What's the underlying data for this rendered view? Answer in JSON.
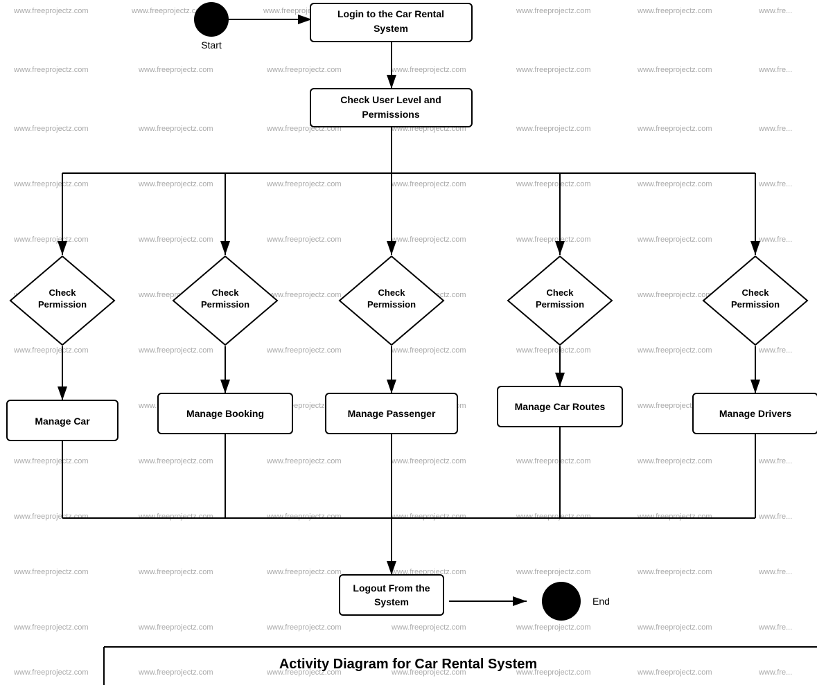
{
  "title": "Activity Diagram for Car Rental System",
  "watermark_text": "www.freeprojectz.com",
  "nodes": {
    "start": {
      "label": "Start"
    },
    "login": {
      "label": "Login to the Car Rental System"
    },
    "check_user": {
      "label": "Check User Level and Permissions"
    },
    "check_perm1": {
      "label": "Check Permission"
    },
    "check_perm2": {
      "label": "Check Permission"
    },
    "check_perm3": {
      "label": "Check Permission"
    },
    "check_perm4": {
      "label": "Check Permission"
    },
    "check_perm5": {
      "label": "Check Permission"
    },
    "manage_car": {
      "label": "Manage Car"
    },
    "manage_booking": {
      "label": "Manage Booking"
    },
    "manage_passenger": {
      "label": "Manage Passenger"
    },
    "manage_car_routes": {
      "label": "Manage Car Routes"
    },
    "manage_drivers": {
      "label": "Manage Drivers"
    },
    "logout": {
      "label": "Logout From the System"
    },
    "end": {
      "label": "End"
    }
  }
}
